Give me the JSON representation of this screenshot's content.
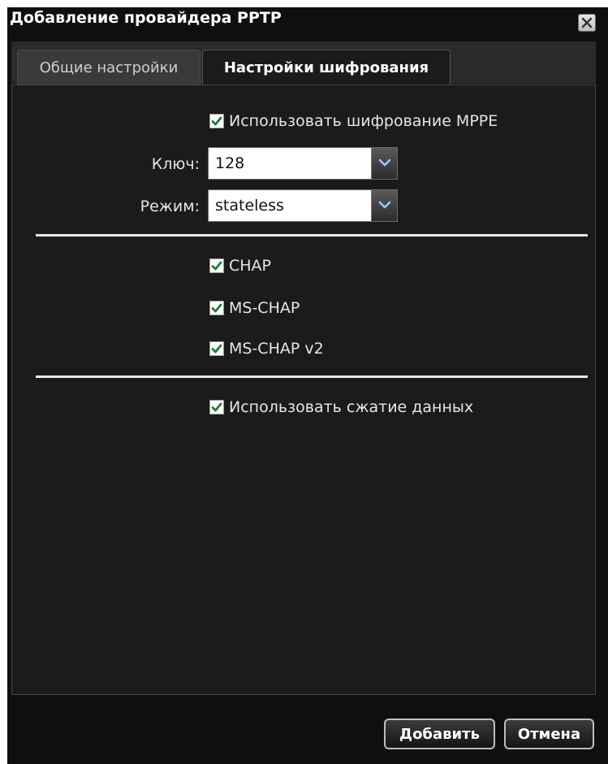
{
  "dialog": {
    "title": "Добавление провайдера PPTP"
  },
  "tabs": [
    {
      "label": "Общие настройки",
      "active": false
    },
    {
      "label": "Настройки шифрования",
      "active": true
    }
  ],
  "encryption": {
    "use_mppe_label": "Использовать шифрование MPPE",
    "use_mppe_checked": true,
    "key_label": "Ключ:",
    "key_value": "128",
    "mode_label": "Режим:",
    "mode_value": "stateless"
  },
  "auth": [
    {
      "label": "CHAP",
      "checked": true
    },
    {
      "label": "MS-CHAP",
      "checked": true
    },
    {
      "label": "MS-CHAP v2",
      "checked": true
    }
  ],
  "compression": {
    "label": "Использовать сжатие данных",
    "checked": true
  },
  "buttons": {
    "add": "Добавить",
    "cancel": "Отмена"
  },
  "colors": {
    "background": "#0f0f0f",
    "panel": "#1b1b1b",
    "checkmark": "#1f7a35"
  }
}
